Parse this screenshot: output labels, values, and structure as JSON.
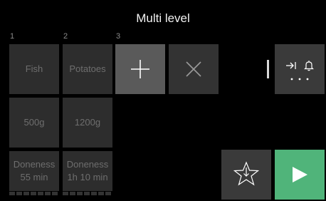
{
  "header": {
    "title": "Multi level"
  },
  "levels": [
    {
      "index": "1",
      "food": "Fish",
      "weight": "500g",
      "doneness_label": "Doneness",
      "time": "55 min"
    },
    {
      "index": "2",
      "food": "Potatoes",
      "weight": "1200g",
      "doneness_label": "Doneness",
      "time": "1h 10 min"
    },
    {
      "index": "3"
    }
  ],
  "actions": {
    "add_icon": "plus-icon",
    "delete_icon": "close-icon",
    "more_icons": [
      "skip-to-end-icon",
      "bell-icon",
      "ellipsis-icon"
    ],
    "favorite_icon": "star-download-icon",
    "start_icon": "play-icon"
  },
  "colors": {
    "background": "#000000",
    "tile": "#2d2d2d",
    "start": "#50b47a",
    "progress_fill": "#5a5a5a",
    "progress_track": "#333333"
  },
  "progress": {
    "segments": 7,
    "filled_level1": 0,
    "filled_level2": 0
  }
}
